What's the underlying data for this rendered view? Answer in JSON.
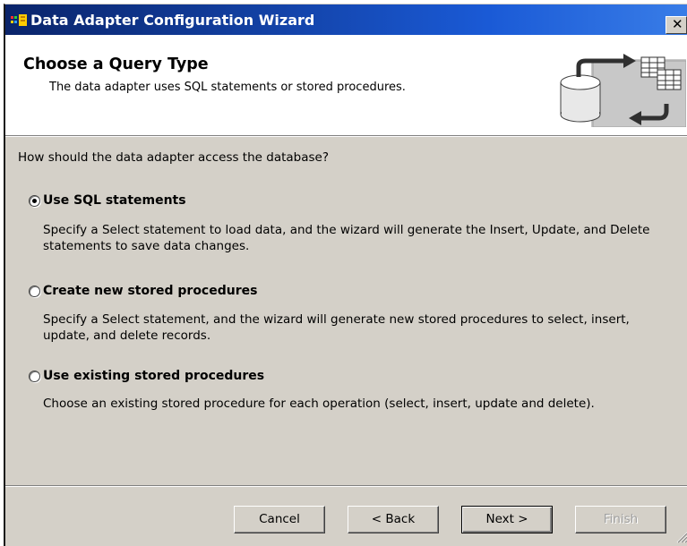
{
  "window": {
    "title": "Data Adapter Configuration Wizard",
    "close_glyph": "✕"
  },
  "header": {
    "title": "Choose a Query Type",
    "subtitle": "The data adapter uses SQL statements or stored procedures."
  },
  "question": "How should the data adapter access the database?",
  "options": [
    {
      "label": "Use SQL statements",
      "selected": true,
      "description": "Specify a Select statement to load data, and the wizard will generate the Insert, Update, and Delete statements to save data changes."
    },
    {
      "label": "Create new stored procedures",
      "selected": false,
      "description": "Specify a Select statement, and the wizard will generate new stored procedures to select, insert, update, and delete records."
    },
    {
      "label": "Use existing stored procedures",
      "selected": false,
      "description": "Choose an existing stored procedure for each operation (select, insert, update and delete)."
    }
  ],
  "buttons": {
    "cancel": "Cancel",
    "back": "< Back",
    "next": "Next >",
    "finish": "Finish"
  },
  "colors": {
    "titlebar_start": "#0a246a",
    "titlebar_end": "#3a7ee8",
    "face": "#d4d0c8"
  }
}
